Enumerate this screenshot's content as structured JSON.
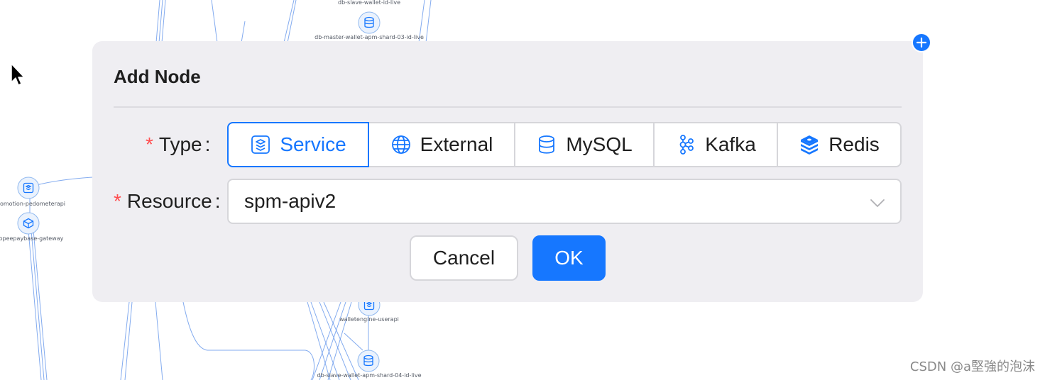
{
  "graph": {
    "nodes": [
      {
        "id": "db-slave-wallet-id-live",
        "label": "db-slave-wallet-id-live",
        "icon": "database-icon"
      },
      {
        "id": "db-master-wallet-apm-shard-03",
        "label": "db-master-wallet-apm-shard-03-id-live",
        "icon": "database-icon"
      },
      {
        "id": "promotion-pedometerapi",
        "label": "omotion-pedometerapi",
        "icon": "service-icon"
      },
      {
        "id": "opeepaybase-gateway",
        "label": "opeepaybase-gateway",
        "icon": "external-box-icon"
      },
      {
        "id": "walletengine-userapi",
        "label": "walletengine-userapi",
        "icon": "service-icon"
      },
      {
        "id": "db-slave-wallet-apm-shard-04",
        "label": "db-slave-wallet-apm-shard-04-id-live",
        "icon": "database-icon"
      }
    ],
    "edge_color": "#6d9cec"
  },
  "fab": {
    "icon": "plus-icon",
    "color": "#1677ff"
  },
  "modal": {
    "title": "Add Node",
    "type_field": {
      "required_mark": "*",
      "label": "Type",
      "colon": ":",
      "options": [
        {
          "label": "Service",
          "icon": "service-icon",
          "selected": true
        },
        {
          "label": "External",
          "icon": "globe-icon",
          "selected": false
        },
        {
          "label": "MySQL",
          "icon": "database-icon",
          "selected": false
        },
        {
          "label": "Kafka",
          "icon": "kafka-icon",
          "selected": false
        },
        {
          "label": "Redis",
          "icon": "redis-icon",
          "selected": false
        }
      ]
    },
    "resource_field": {
      "required_mark": "*",
      "label": "Resource",
      "colon": ":",
      "value": "spm-apiv2",
      "arrow_icon": "chevron-down-icon"
    },
    "buttons": {
      "cancel": "Cancel",
      "ok": "OK"
    }
  },
  "colors": {
    "accent": "#1677ff",
    "required": "#ff4d4f",
    "modal_bg": "#efeef2"
  },
  "watermark": "CSDN @a堅強的泡沫"
}
